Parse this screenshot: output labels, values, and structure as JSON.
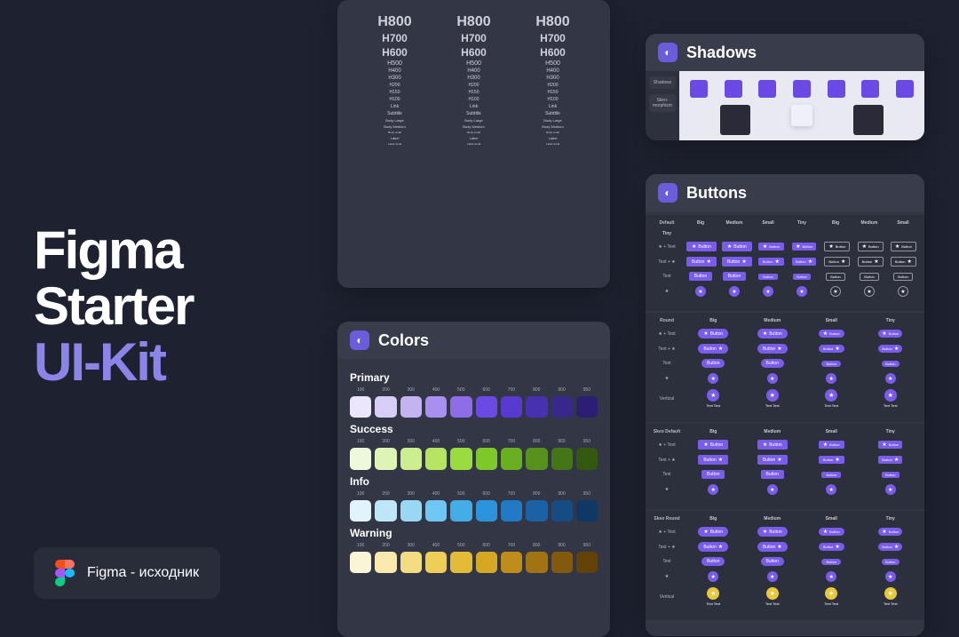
{
  "hero": {
    "line1": "Figma",
    "line2": "Starter",
    "line3": "UI-Kit"
  },
  "figma_source": "Figma - исходник",
  "typography": {
    "rows": [
      "H800",
      "H700",
      "H600",
      "H500",
      "H400",
      "H300",
      "H200",
      "H150",
      "H100",
      "Link",
      "Subtitle",
      "Body Large",
      "Body Medium",
      "Body small",
      "Label",
      "Label small"
    ]
  },
  "colors": {
    "title": "Colors",
    "shade_labels": [
      "100",
      "200",
      "300",
      "400",
      "500",
      "600",
      "700",
      "800",
      "900",
      "950"
    ],
    "sections": [
      {
        "name": "Primary",
        "swatches": [
          "#ebe6fb",
          "#d8cdf6",
          "#c4b3f1",
          "#a98ff0",
          "#8f6ce7",
          "#6a49e5",
          "#583ad1",
          "#4831b1",
          "#39288c",
          "#2b1e73"
        ]
      },
      {
        "name": "Success",
        "swatches": [
          "#eef9d9",
          "#def4b4",
          "#cdee8e",
          "#b5e662",
          "#9adb3d",
          "#7fc82a",
          "#6aae21",
          "#55911b",
          "#447516",
          "#335810"
        ]
      },
      {
        "name": "Info",
        "swatches": [
          "#e1f3fb",
          "#bde6f8",
          "#98d8f5",
          "#6ec7f2",
          "#44ade7",
          "#2b94dc",
          "#2279c6",
          "#1b61a5",
          "#154c84",
          "#0f3864"
        ]
      },
      {
        "name": "Warning",
        "swatches": [
          "#fcf4d6",
          "#f9e9ad",
          "#f4dc82",
          "#efce58",
          "#e4bb36",
          "#d6a723",
          "#bf8e1a",
          "#a27312",
          "#835a0d",
          "#634208"
        ]
      }
    ]
  },
  "shadows": {
    "title": "Shadows",
    "tabs": [
      "Shadows",
      "Skeo-morphism"
    ]
  },
  "buttons": {
    "title": "Buttons",
    "columns": [
      "Big",
      "Medium",
      "Small",
      "Tiny"
    ],
    "button_label": "Button",
    "label_text": "Text",
    "sections": [
      {
        "name": "Default",
        "wide": true,
        "rows": [
          "★ + Text",
          "Text + ★",
          "Text",
          "★"
        ],
        "extra_cols": [
          "Big",
          "Medium",
          "Small",
          "Tiny"
        ]
      },
      {
        "name": "Round",
        "rows": [
          "★ + Text",
          "Text + ★",
          "Text",
          "★",
          "Vertical"
        ]
      },
      {
        "name": "Skeo Default",
        "rows": [
          "★ + Text",
          "Text + ★",
          "Text",
          "★"
        ]
      },
      {
        "name": "Skeo Round",
        "rows": [
          "★ + Text",
          "Text + ★",
          "Text",
          "★",
          "Vertical"
        ]
      }
    ],
    "accent": "#7a5ceb",
    "alt_accent": "#e8c83c"
  }
}
